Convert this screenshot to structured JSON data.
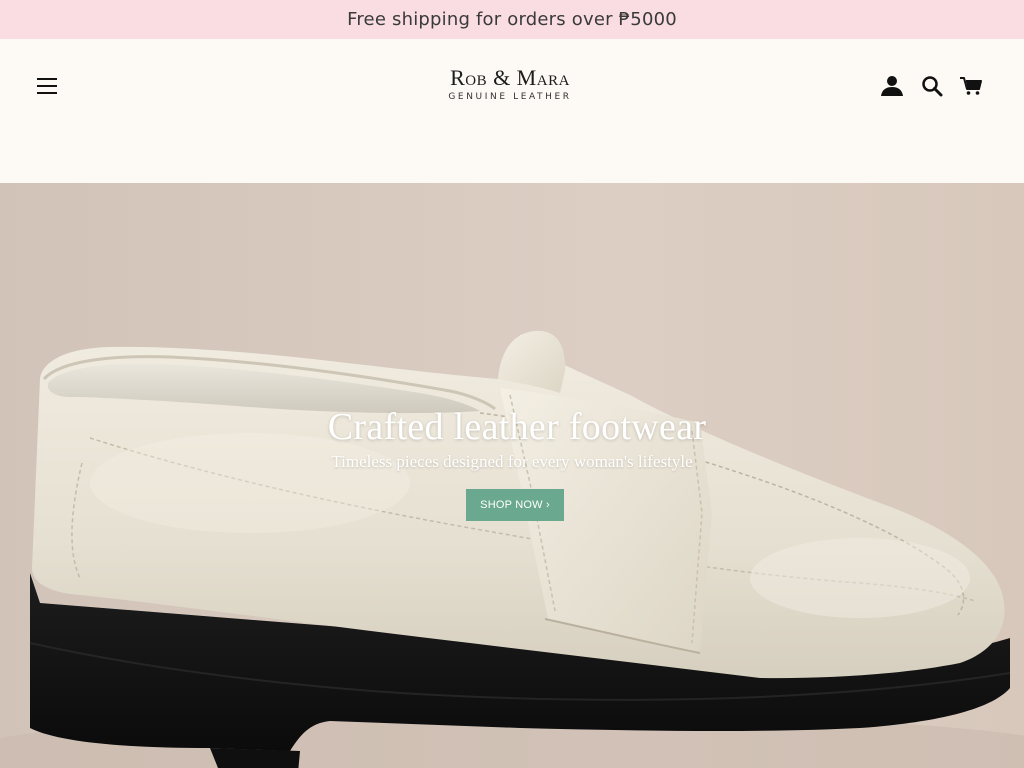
{
  "announcement": {
    "text": "Free shipping for orders over ₱5000"
  },
  "header": {
    "menu_icon": "hamburger-menu-icon",
    "logo": {
      "brand": "Rob & Mara",
      "tagline": "GENUINE LEATHER"
    },
    "icons": [
      "account-icon",
      "search-icon",
      "cart-icon"
    ]
  },
  "hero": {
    "title": "Crafted leather footwear",
    "subtitle": "Timeless pieces designed for every woman's lifestyle",
    "cta_label": "SHOP NOW ›"
  },
  "colors": {
    "announcement_bg": "#f9dde2",
    "header_bg": "#fdfaf6",
    "cta_bg": "#6aa890",
    "hero_bg": "#d9cabe"
  }
}
